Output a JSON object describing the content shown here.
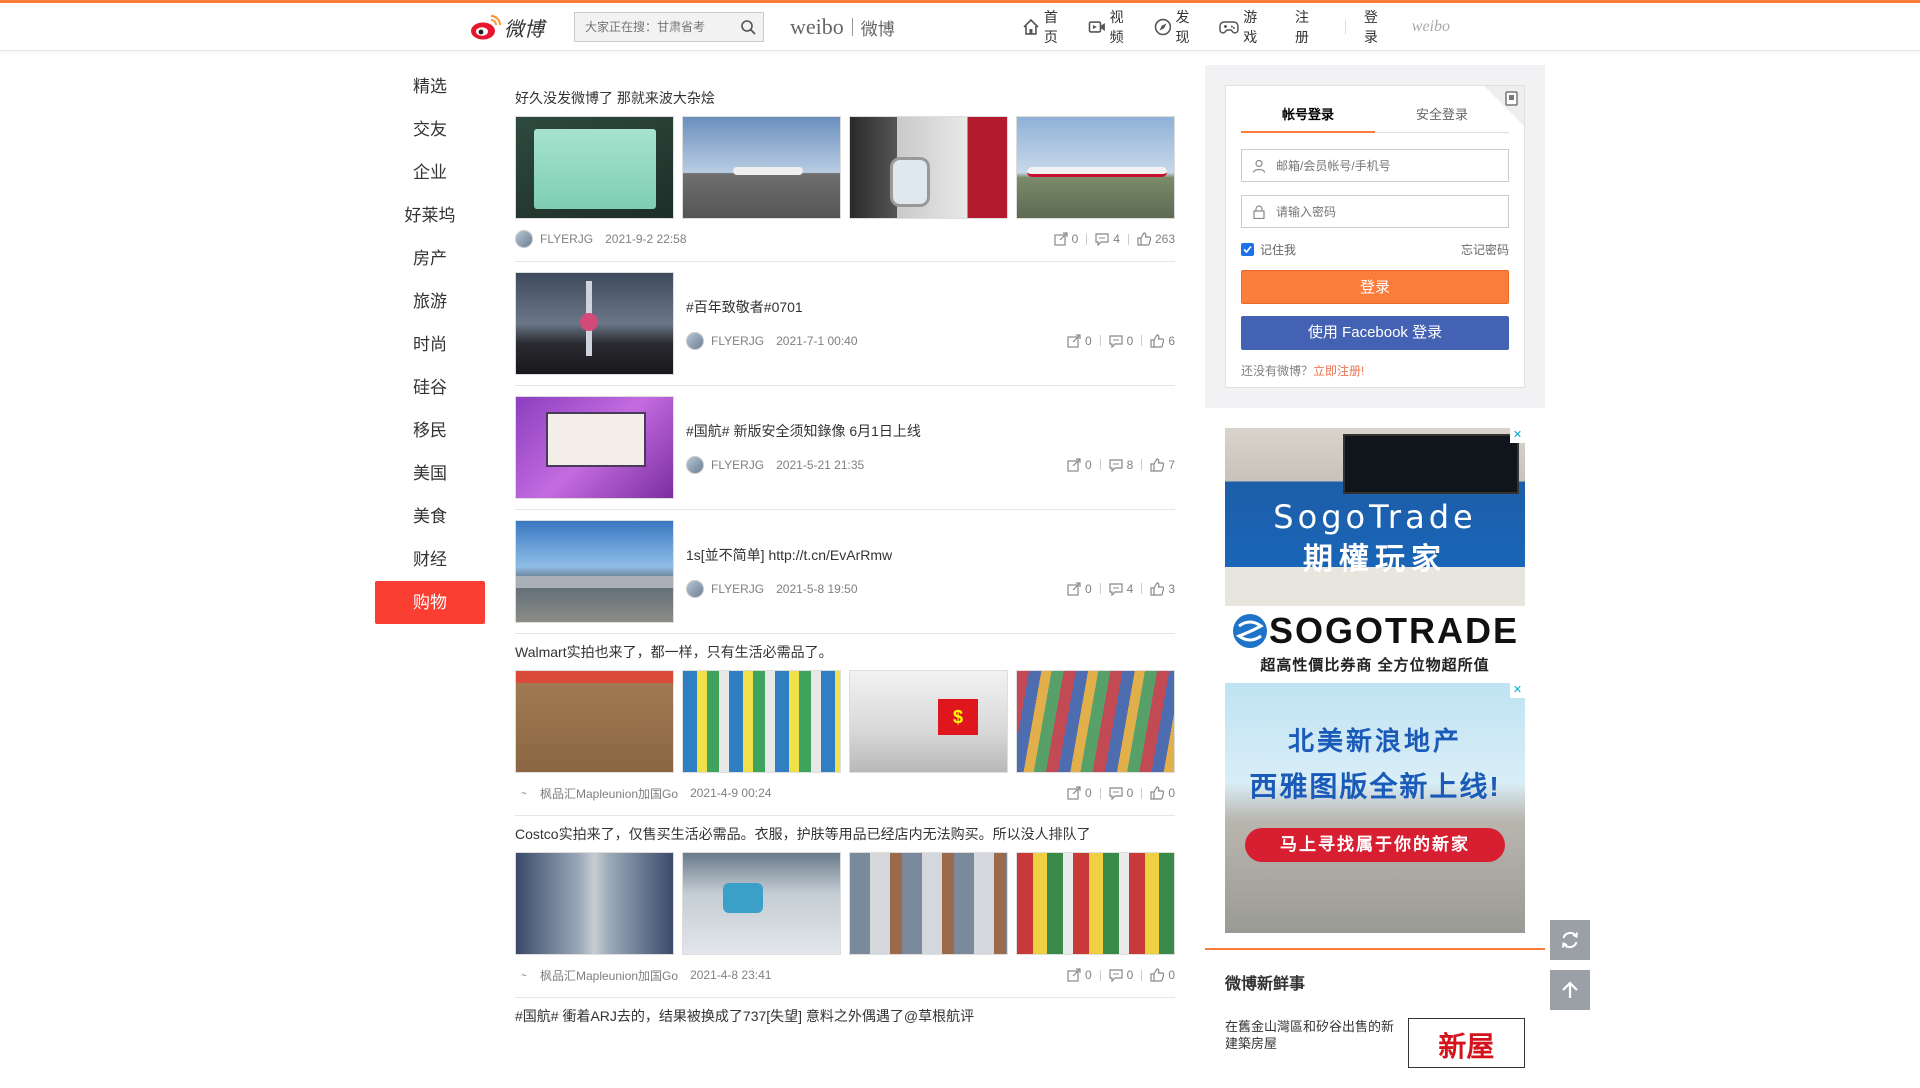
{
  "header": {
    "logo_text": "微博",
    "search_placeholder": "大家正在搜：甘肃省考",
    "brand_en": "weibo",
    "brand_cn": "微博",
    "nav": [
      {
        "label": "首页",
        "icon": "home-icon"
      },
      {
        "label": "视频",
        "icon": "video-icon"
      },
      {
        "label": "发现",
        "icon": "compass-icon"
      },
      {
        "label": "游戏",
        "icon": "gamepad-icon"
      }
    ],
    "register": "注册",
    "login": "登录",
    "weibo_small": "weibo"
  },
  "sidebar": {
    "items": [
      "精选",
      "交友",
      "企业",
      "好莱坞",
      "房产",
      "旅游",
      "时尚",
      "硅谷",
      "移民",
      "美国",
      "美食",
      "财经",
      "购物"
    ],
    "active": "购物"
  },
  "feed": {
    "posts": [
      {
        "title": "好久没发微博了 那就来波大杂烩",
        "author": "FLYERJG",
        "time": "2021-9-2 22:58",
        "shares": "0",
        "comments": "4",
        "likes": "263"
      },
      {
        "title": "#百年致敬者#0701",
        "author": "FLYERJG",
        "time": "2021-7-1 00:40",
        "shares": "0",
        "comments": "0",
        "likes": "6"
      },
      {
        "title": "#国航# 新版安全须知錄像 6月1日上线",
        "author": "FLYERJG",
        "time": "2021-5-21 21:35",
        "shares": "0",
        "comments": "8",
        "likes": "7"
      },
      {
        "title": "1s[並不简单] http://t.cn/EvArRmw",
        "author": "FLYERJG",
        "time": "2021-5-8 19:50",
        "shares": "0",
        "comments": "4",
        "likes": "3"
      },
      {
        "title": "Walmart实拍也来了，都一样，只有生活必需品了。",
        "author": "枫品汇Mapleunion加国Go",
        "time": "2021-4-9 00:24",
        "shares": "0",
        "comments": "0",
        "likes": "0"
      },
      {
        "title": "Costco实拍来了，仅售买生活必需品。衣服，护肤等用品已经店内无法购买。所以没人排队了",
        "author": "枫品汇Mapleunion加国Go",
        "time": "2021-4-8 23:41",
        "shares": "0",
        "comments": "0",
        "likes": "0"
      },
      {
        "title": "#国航# 衝着ARJ去的，结果被换成了737[失望] 意料之外偶遇了@草根航评"
      }
    ]
  },
  "login": {
    "tab_account": "帐号登录",
    "tab_secure": "安全登录",
    "username_placeholder": "邮箱/会员帐号/手机号",
    "password_placeholder": "请输入密码",
    "remember": "记住我",
    "forgot": "忘记密码",
    "login_button": "登录",
    "facebook_button": "使用 Facebook 登录",
    "no_account": "还没有微博？",
    "register_now": "立即注册!"
  },
  "ads": {
    "ad1_line1": "SogoTrade",
    "ad1_line2": "期權玩家",
    "sogo_brand": "SOGOTRADE",
    "sogo_tagline": "超高性價比券商 全方位物超所值",
    "ad2_line1": "北美新浪地产",
    "ad2_line2": "西雅图版全新上线!",
    "ad2_pill": "马上寻找属于你的新家",
    "close": "✕"
  },
  "news": {
    "title": "微博新鲜事",
    "item_text": "在舊金山灣區和矽谷出售的新建築房屋",
    "item_img": "新屋"
  },
  "colors": {
    "accent": "#fa7d3c",
    "active_red": "#fa3e32",
    "facebook": "#4462b3",
    "link": "#eb7350"
  }
}
